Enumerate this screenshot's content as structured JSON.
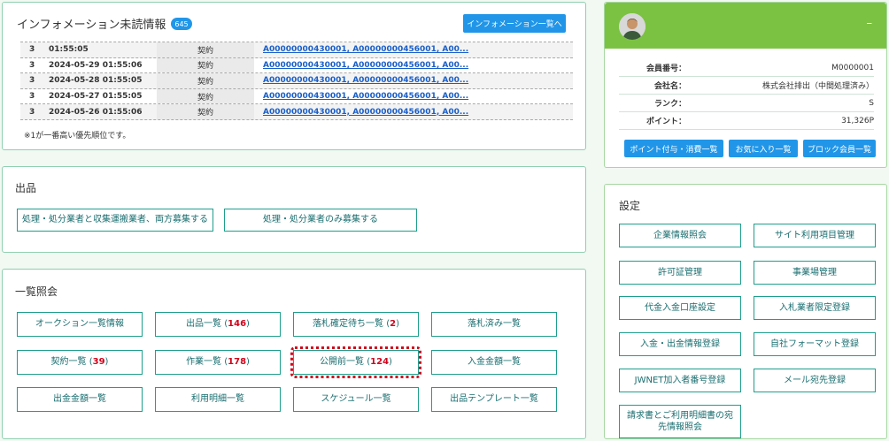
{
  "info": {
    "title": "インフォメーション未読情報",
    "badge": "645",
    "list_button": "インフォメーション一覧へ",
    "rows": [
      {
        "priority": "3",
        "date": "01:55:05",
        "type": "契約",
        "link": "A00000000430001, A00000000456001, A00..."
      },
      {
        "priority": "3",
        "date": "2024-05-29 01:55:06",
        "type": "契約",
        "link": "A00000000430001, A00000000456001, A00..."
      },
      {
        "priority": "3",
        "date": "2024-05-28 01:55:05",
        "type": "契約",
        "link": "A00000000430001, A00000000456001, A00..."
      },
      {
        "priority": "3",
        "date": "2024-05-27 01:55:05",
        "type": "契約",
        "link": "A00000000430001, A00000000456001, A00..."
      },
      {
        "priority": "3",
        "date": "2024-05-26 01:55:06",
        "type": "契約",
        "link": "A00000000430001, A00000000456001, A00..."
      }
    ],
    "note": "※1が一番高い優先順位です。"
  },
  "listing": {
    "title": "出品",
    "btn_both": "処理・処分業者と収集運搬業者、両方募集する",
    "btn_only": "処理・処分業者のみ募集する"
  },
  "inquiry": {
    "title": "一覧照会",
    "auction": "オークション一覧情報",
    "listings_label": "出品一覧 (",
    "listings_count": "146",
    "listings_close": ")",
    "pending_label": "落札確定待ち一覧 (",
    "pending_count": "2",
    "pending_close": ")",
    "won": "落札済み一覧",
    "contracts_label": "契約一覧 (",
    "contracts_count": "39",
    "contracts_close": ")",
    "work_label": "作業一覧 (",
    "work_count": "178",
    "work_close": ")",
    "prepub_label": "公開前一覧 (",
    "prepub_count": "124",
    "prepub_close": ")",
    "deposit": "入金金額一覧",
    "withdraw": "出金金額一覧",
    "usage": "利用明細一覧",
    "schedule": "スケジュール一覧",
    "template": "出品テンプレート一覧"
  },
  "member": {
    "collapse": "–",
    "rows": [
      {
        "label": "会員番号：",
        "value": "M0000001"
      },
      {
        "label": "会社名：",
        "value": "株式会社排出（中間処理済み）"
      },
      {
        "label": "ランク：",
        "value": "S"
      },
      {
        "label": "ポイント：",
        "value": "31,326P"
      }
    ],
    "btn_points": "ポイント付与・消費一覧",
    "btn_favorites": "お気に入り一覧",
    "btn_blocked": "ブロック会員一覧"
  },
  "settings": {
    "title": "設定",
    "company": "企業情報照会",
    "site_items": "サイト利用項目管理",
    "permit": "許可証管理",
    "office": "事業場管理",
    "bank": "代金入金口座設定",
    "bidder": "入札業者限定登録",
    "inout": "入金・出金情報登録",
    "format": "自社フォーマット登録",
    "jwnet": "JWNET加入者番号登録",
    "mail": "メール宛先登録",
    "invoice": "請求書とご利用明細書の宛先情報照会"
  },
  "colors": {
    "accent": "#2196e8",
    "teal": "#1e9e8c",
    "green_header": "#7cc242",
    "count_red": "#d0021b"
  }
}
